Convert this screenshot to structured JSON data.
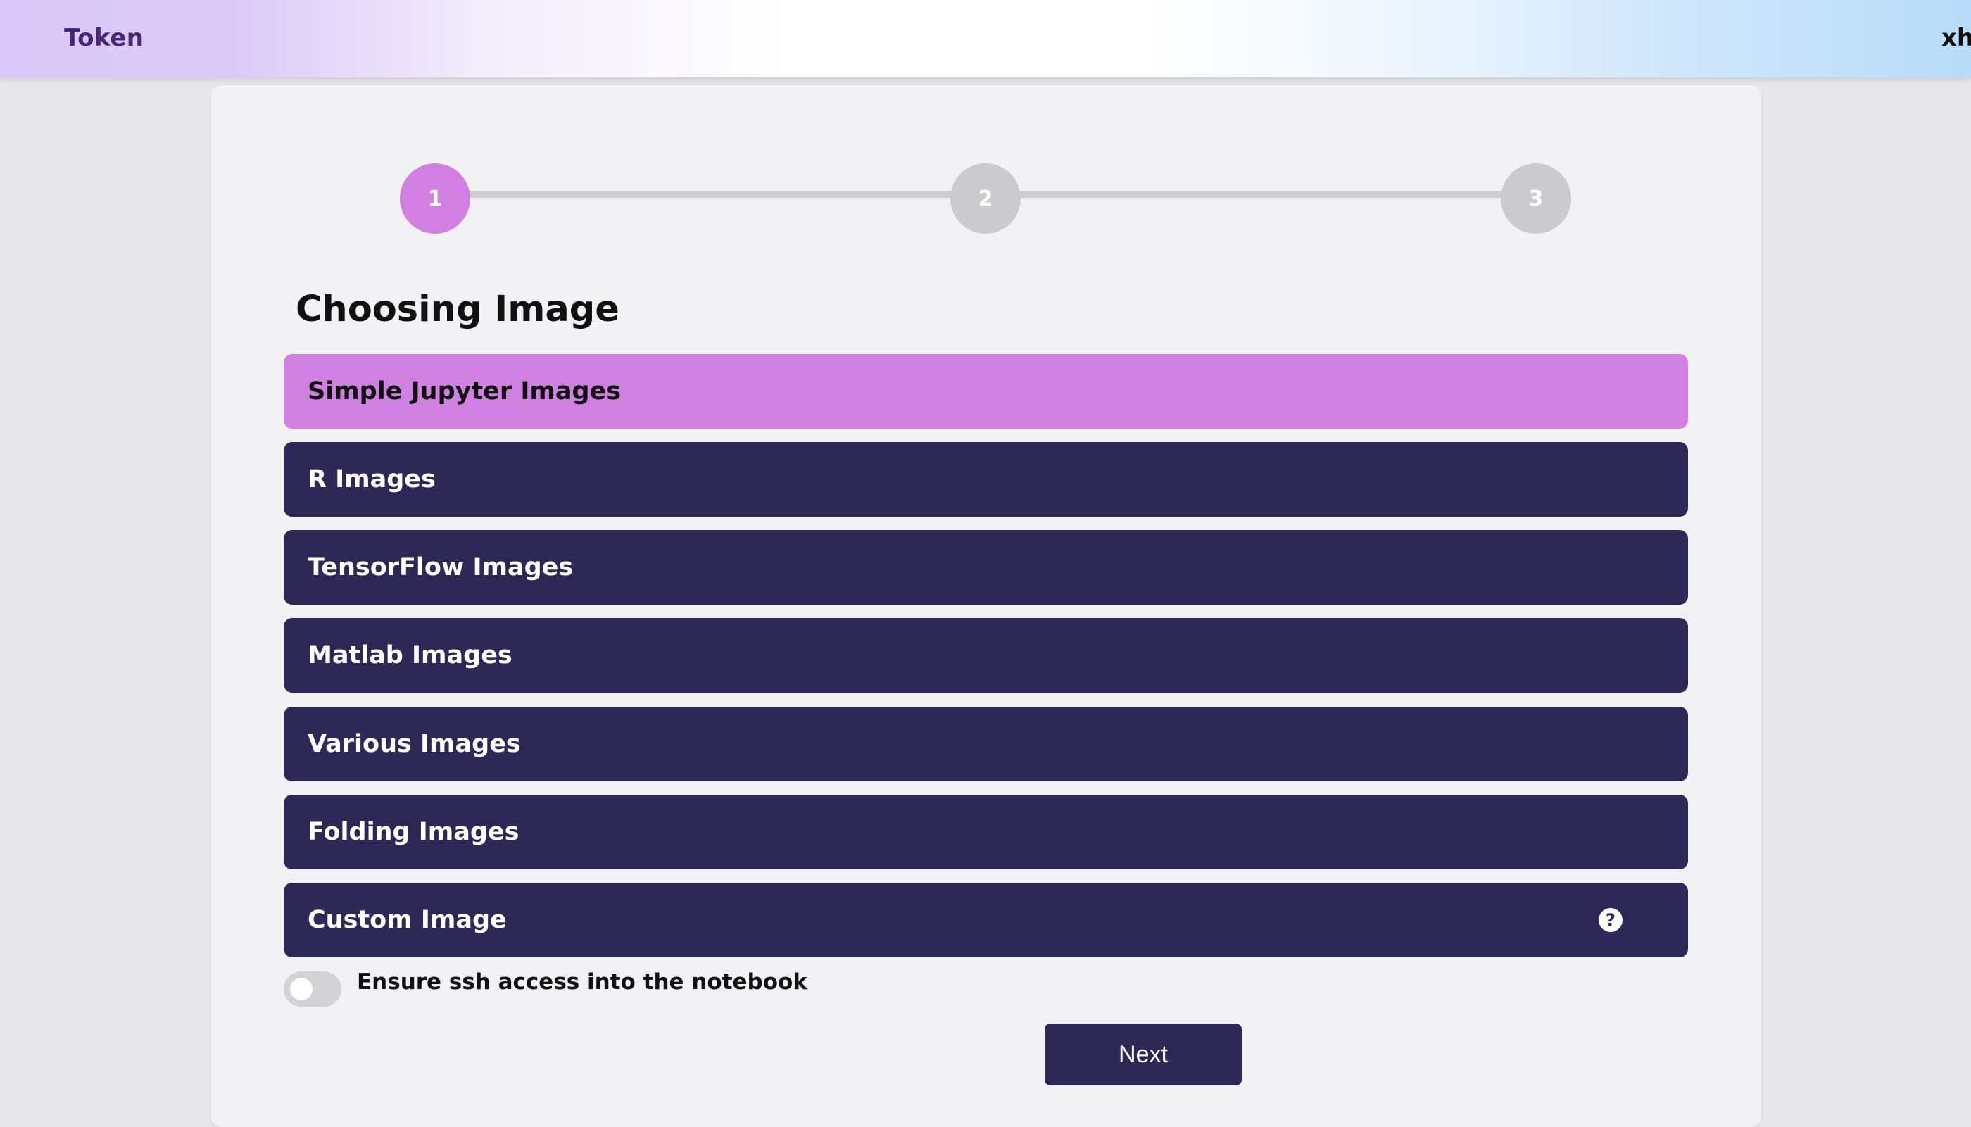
{
  "header": {
    "brand": "Token",
    "user": "xh"
  },
  "stepper": {
    "steps": [
      {
        "label": "1",
        "active": true
      },
      {
        "label": "2",
        "active": false
      },
      {
        "label": "3",
        "active": false
      }
    ]
  },
  "main": {
    "heading": "Choosing Image",
    "options": [
      {
        "label": "Simple Jupyter Images",
        "selected": true
      },
      {
        "label": "R Images",
        "selected": false
      },
      {
        "label": "TensorFlow Images",
        "selected": false
      },
      {
        "label": "Matlab Images",
        "selected": false
      },
      {
        "label": "Various Images",
        "selected": false
      },
      {
        "label": "Folding Images",
        "selected": false
      },
      {
        "label": "Custom Image",
        "selected": false,
        "help_icon": "?"
      }
    ],
    "ssh_toggle": {
      "label": "Ensure ssh access into the notebook",
      "enabled": false
    },
    "next_label": "Next"
  },
  "colors": {
    "accent": "#d080e1",
    "option_bg": "#2e2856",
    "brand_text": "#4a2477"
  }
}
